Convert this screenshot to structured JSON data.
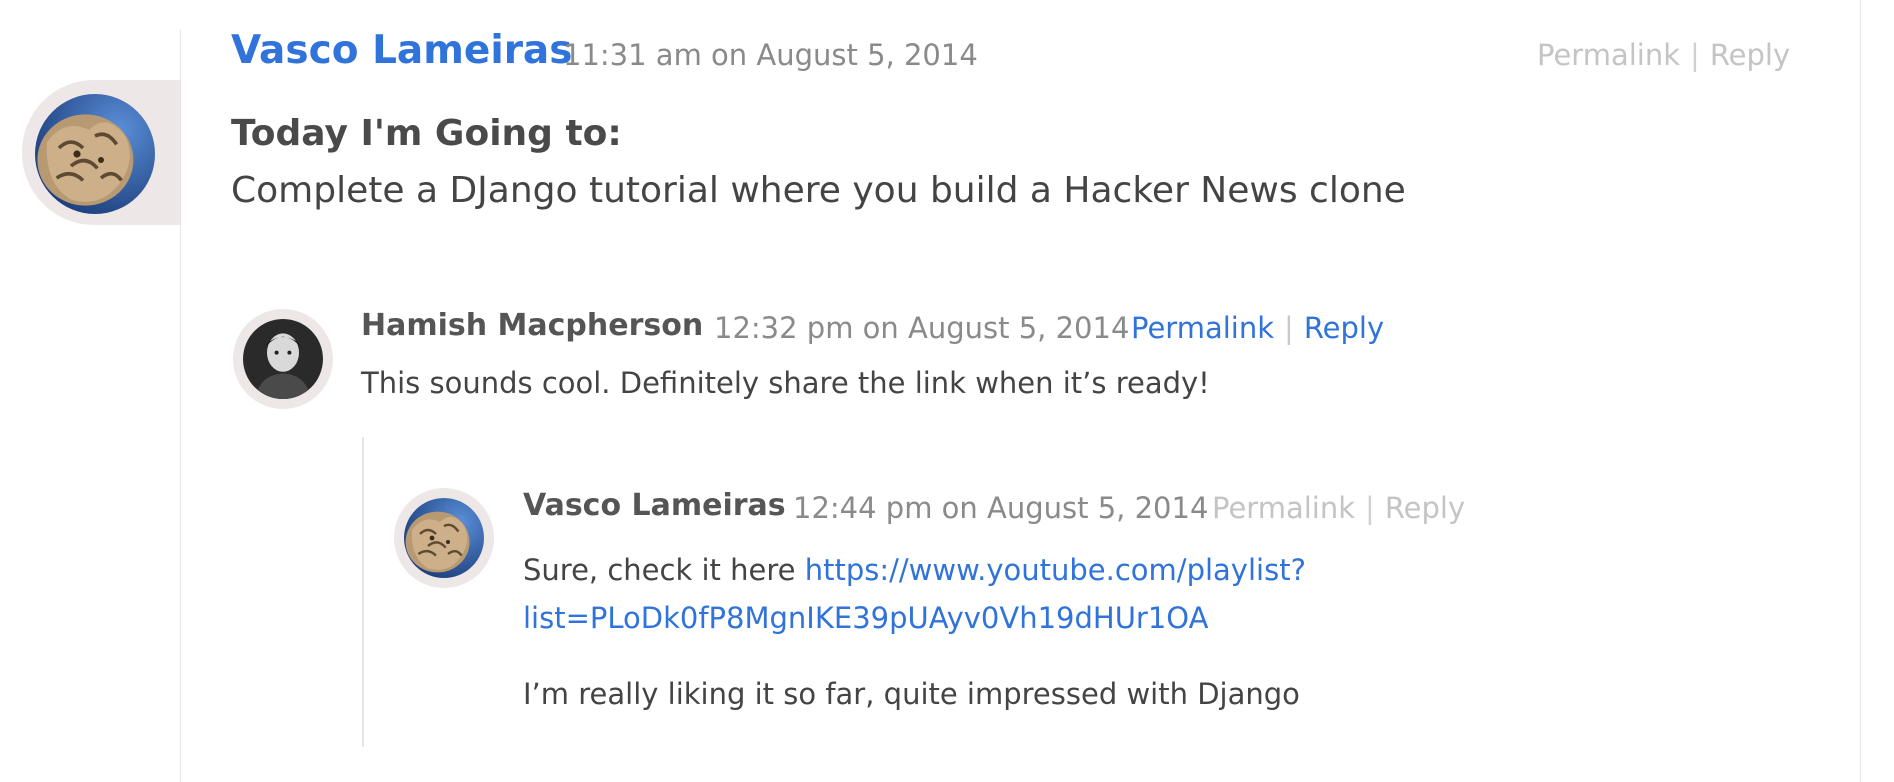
{
  "colors": {
    "link": "#2f73db",
    "muted": "#8a8a8a",
    "faint": "#c4c4c4",
    "tab": "#ede7e7"
  },
  "post": {
    "author": "Vasco Lameiras",
    "time": "11:31 am on August 5, 2014",
    "permalink": "Permalink",
    "separator": "|",
    "reply": "Reply",
    "heading": "Today I'm Going to:",
    "goal": "Complete a DJango tutorial where you build a Hacker News clone",
    "avatar_icon": "lion-statue-avatar"
  },
  "comments": [
    {
      "author": "Hamish Macpherson",
      "time": "12:32 pm on August 5, 2014",
      "permalink": "Permalink",
      "separator": "|",
      "reply": "Reply",
      "text": "This sounds cool. Definitely share the link when it’s ready!",
      "avatar_icon": "person-photo-avatar"
    },
    {
      "author": "Vasco Lameiras",
      "time": "12:44 pm on August 5, 2014",
      "permalink": "Permalink",
      "separator": "|",
      "reply": "Reply",
      "text_prefix": "Sure, check it here ",
      "link": "https://www.youtube.com/playlist?list=PLoDk0fP8MgnIKE39pUAyv0Vh19dHUr1OA",
      "link_line1": "https://www.youtube.com/playlist?",
      "link_line2": "list=PLoDk0fP8MgnIKE39pUAyv0Vh19dHUr1OA",
      "text2": "I’m really liking it so far, quite impressed with Django",
      "avatar_icon": "lion-statue-avatar"
    }
  ]
}
